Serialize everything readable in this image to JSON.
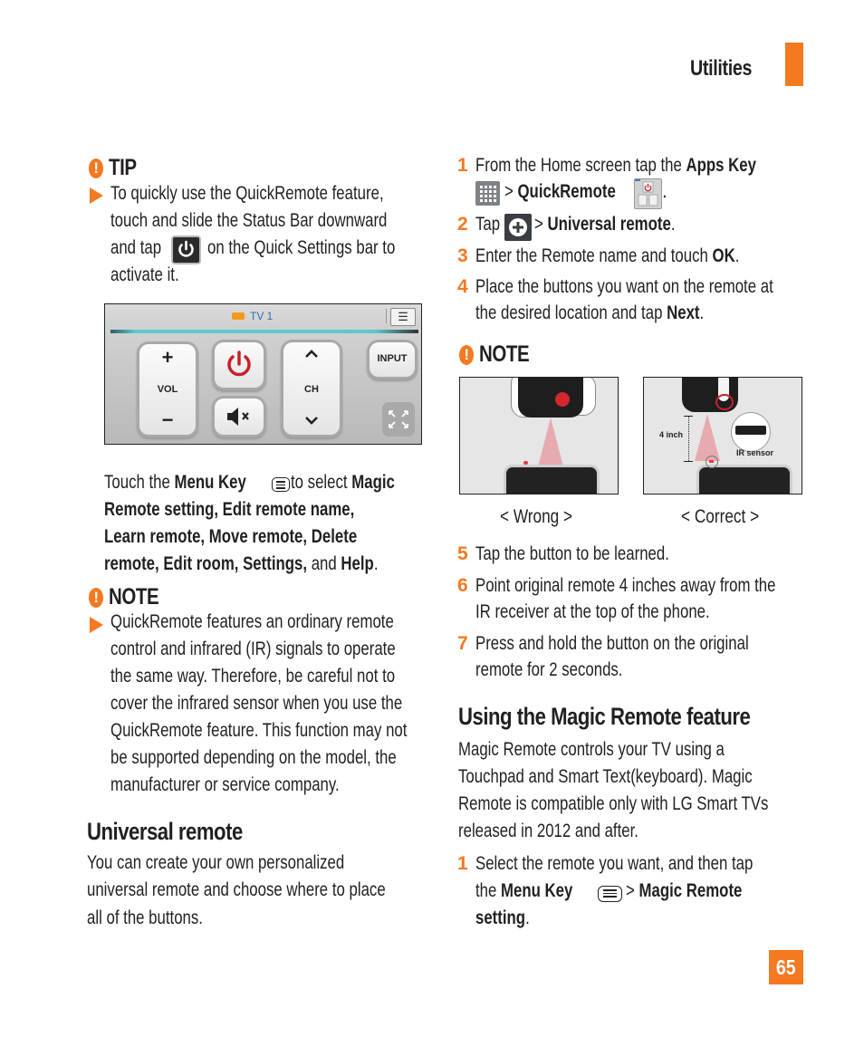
{
  "header": {
    "section_title": "Utilities",
    "accent_color": "#f47920"
  },
  "left": {
    "tip": {
      "label": "TIP",
      "lines": [
        "To quickly use the QuickRemote feature,",
        "touch and slide the Status Bar downward",
        [
          "and tap",
          "on the Quick Settings bar to"
        ],
        "activate it."
      ],
      "icon": "quickremote-power-icon"
    },
    "remote_screenshot": {
      "room_label": "TV 1",
      "buttons": {
        "vol_plus": "+",
        "vol": "VOL",
        "vol_minus": "−",
        "ch": "CH",
        "input": "INPUT"
      }
    },
    "menu_text": {
      "l1_a": "Touch the ",
      "l1_b": "Menu Key",
      "l1_c": " to select ",
      "l1_d": "Magic",
      "l2": "Remote setting, Edit remote name,",
      "l3": "Learn remote, Move remote, Delete",
      "l4_a": "remote, Edit room, Settings,",
      "l4_b": " and ",
      "l4_c": "Help",
      "l4_d": "."
    },
    "note": {
      "label": "NOTE",
      "lines": [
        "QuickRemote features an ordinary remote",
        "control and infrared (IR) signals to operate",
        "the same way. Therefore, be careful not to",
        "cover the infrared sensor when you use the",
        "QuickRemote feature. This function may not",
        "be supported depending on the model, the",
        "manufacturer or service company."
      ]
    },
    "universal": {
      "heading": "Universal remote",
      "lines": [
        "You can create your own personalized",
        "universal remote and choose where to place",
        "all of the buttons."
      ]
    }
  },
  "right": {
    "steps": [
      {
        "n": "1",
        "a": "From the Home screen tap the ",
        "b": "Apps Key",
        "c": " > ",
        "d": "QuickRemote",
        "e": "."
      },
      {
        "n": "2",
        "a": "Tap ",
        "b": " > ",
        "c": "Universal remote",
        "d": "."
      },
      {
        "n": "3",
        "a": "Enter the Remote name and touch ",
        "b": "OK",
        "c": "."
      },
      {
        "n": "4",
        "a": "Place the buttons you want on the remote at",
        "b": "the desired location and tap ",
        "c": "Next",
        "d": "."
      }
    ],
    "note": {
      "label": "NOTE",
      "wrong_caption": "< Wrong >",
      "correct_caption": "< Correct >",
      "distance_label": "4 inch",
      "sensor_label": "IR sensor"
    },
    "steps2": [
      {
        "n": "5",
        "lines": [
          "Tap the button to be learned."
        ]
      },
      {
        "n": "6",
        "lines": [
          "Point original remote 4 inches away from the",
          "IR receiver at the top of the phone."
        ]
      },
      {
        "n": "7",
        "lines": [
          "Press and hold the button on the original",
          "remote for 2 seconds."
        ]
      }
    ],
    "magic": {
      "heading": "Using the Magic Remote feature",
      "lines": [
        "Magic Remote controls your TV using a",
        "Touchpad and Smart Text(keyboard). Magic",
        "Remote is compatible only with LG Smart TVs",
        "released in 2012 and after."
      ],
      "step": {
        "n": "1",
        "l1": "Select the remote you want, and then tap",
        "l2_a": "the ",
        "l2_b": "Menu Key",
        "l2_c": " > ",
        "l2_d": "Magic Remote",
        "l3_a": "setting",
        "l3_b": "."
      }
    }
  },
  "footer": {
    "page_number": "65"
  }
}
